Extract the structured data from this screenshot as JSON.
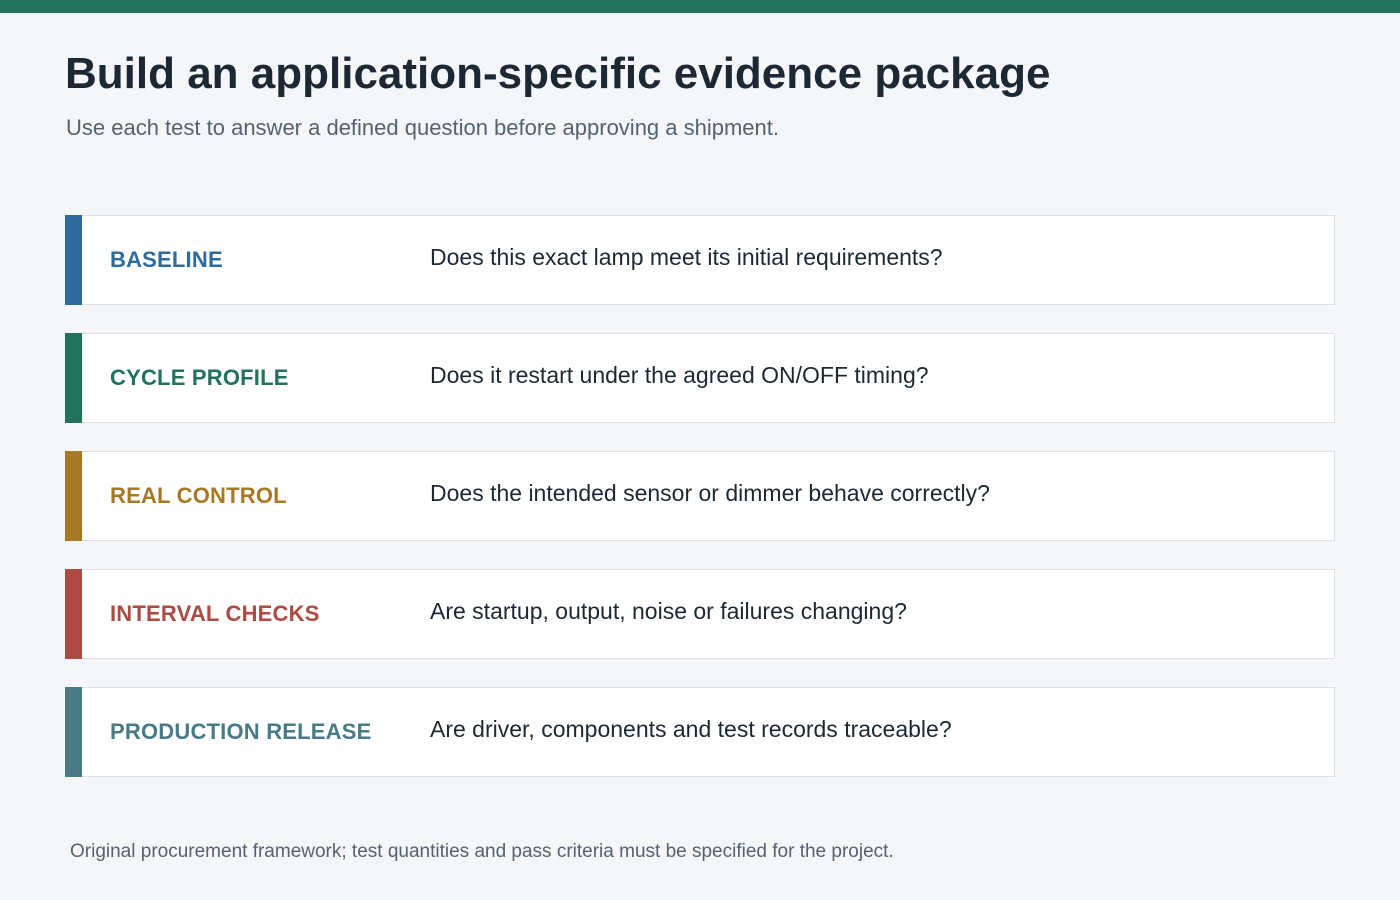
{
  "theme": {
    "top_bar_color": "#21735a"
  },
  "header": {
    "title": "Build an application-specific evidence package",
    "subtitle": "Use each test to answer a defined question before approving a shipment."
  },
  "stages": [
    {
      "label": "BASELINE",
      "question": "Does this exact lamp meet its initial requirements?",
      "color": "#2f6b9e"
    },
    {
      "label": "CYCLE PROFILE",
      "question": "Does it restart under the agreed ON/OFF timing?",
      "color": "#21735a"
    },
    {
      "label": "REAL CONTROL",
      "question": "Does the intended sensor or dimmer behave correctly?",
      "color": "#a87924"
    },
    {
      "label": "INTERVAL CHECKS",
      "question": "Are startup, output, noise or failures changing?",
      "color": "#ac4a44"
    },
    {
      "label": "PRODUCTION RELEASE",
      "question": "Are driver, components and test records traceable?",
      "color": "#487b85"
    }
  ],
  "footer": {
    "note": "Original procurement framework; test quantities and pass criteria must be specified for the project."
  }
}
